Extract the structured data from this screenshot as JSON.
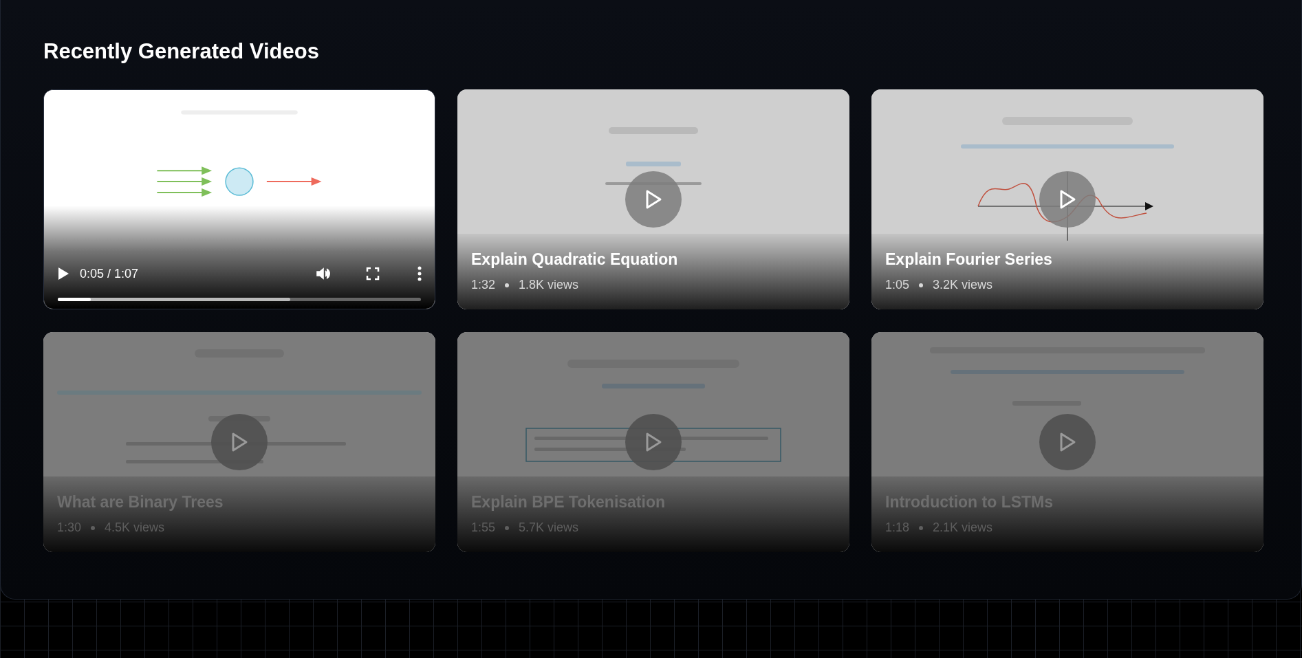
{
  "heading": "Recently Generated Videos",
  "videos": [
    {
      "kind": "player",
      "dimmed": false,
      "player": {
        "playing": false,
        "time": "0:05 / 1:07",
        "progress": {
          "level": 0.09
        },
        "buffered": {
          "level": 0.64
        }
      }
    },
    {
      "kind": "thumbnail",
      "dimmed": false,
      "title": "Explain Quadratic Equation",
      "duration": "1:32",
      "views": "1.8K views"
    },
    {
      "kind": "thumbnail",
      "dimmed": false,
      "title": "Explain Fourier Series",
      "duration": "1:05",
      "views": "3.2K views"
    },
    {
      "kind": "thumbnail",
      "dimmed": true,
      "title": "What are Binary Trees",
      "duration": "1:30",
      "views": "4.5K views"
    },
    {
      "kind": "thumbnail",
      "dimmed": true,
      "title": "Explain BPE Tokenisation",
      "duration": "1:55",
      "views": "5.7K views"
    },
    {
      "kind": "thumbnail",
      "dimmed": true,
      "title": "Introduction to LSTMs",
      "duration": "1:18",
      "views": "2.1K views"
    }
  ]
}
